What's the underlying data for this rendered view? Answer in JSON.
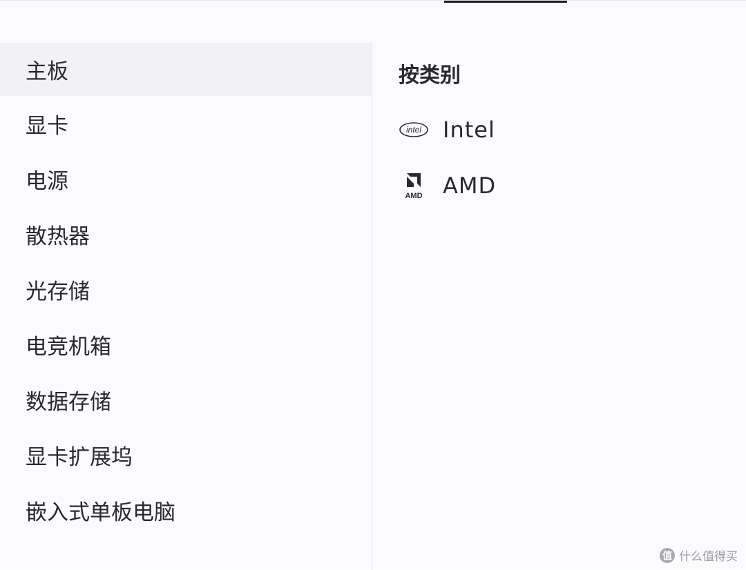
{
  "sidebar": {
    "items": [
      {
        "label": "主板",
        "active": true
      },
      {
        "label": "显卡",
        "active": false
      },
      {
        "label": "电源",
        "active": false
      },
      {
        "label": "散热器",
        "active": false
      },
      {
        "label": "光存储",
        "active": false
      },
      {
        "label": "电竞机箱",
        "active": false
      },
      {
        "label": "数据存储",
        "active": false
      },
      {
        "label": "显卡扩展坞",
        "active": false
      },
      {
        "label": "嵌入式单板电脑",
        "active": false
      }
    ]
  },
  "panel": {
    "heading": "按类别",
    "brands": [
      {
        "label": "Intel",
        "icon": "intel-logo-icon",
        "logo_text": "intel"
      },
      {
        "label": "AMD",
        "icon": "amd-logo-icon",
        "logo_text": "AMD"
      }
    ]
  },
  "watermark": {
    "text": "什么值得买",
    "logo_char": "值"
  },
  "colors": {
    "active_row_bg": "#f2f2f4",
    "text": "#2a2a2e",
    "divider": "#e6e6eb",
    "tab_indicator": "#1f1f24"
  }
}
